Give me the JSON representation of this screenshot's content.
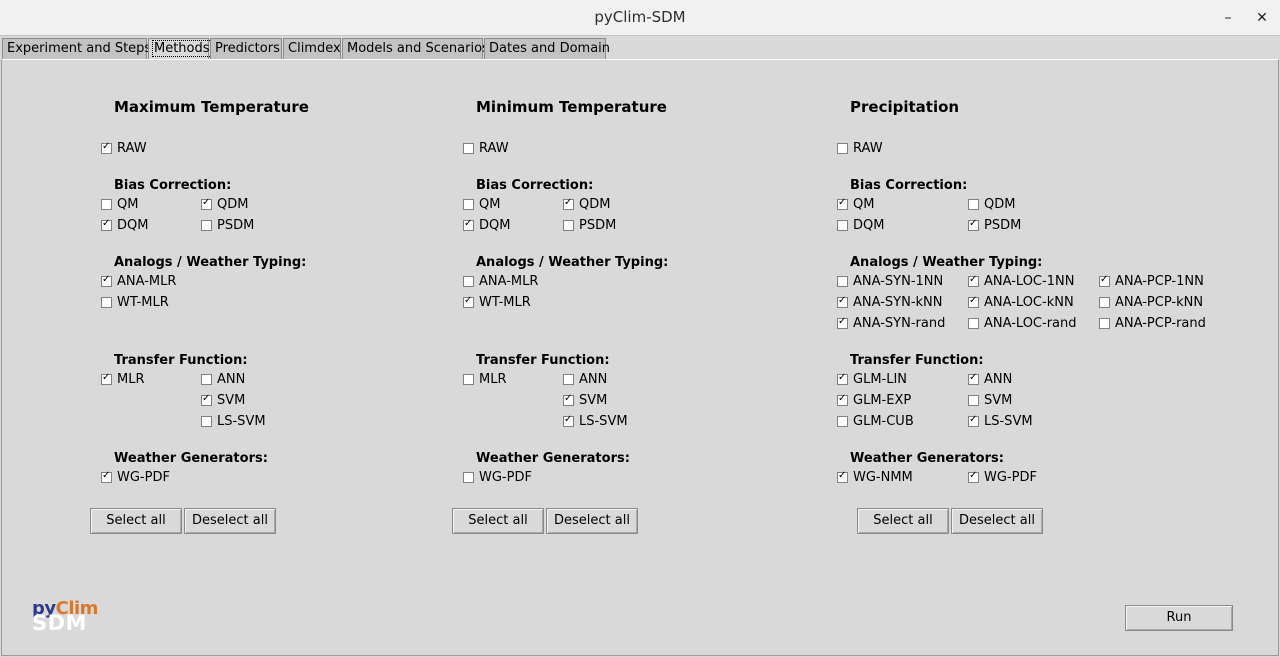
{
  "window": {
    "title": "pyClim-SDM",
    "minimize": "–",
    "close": "✕"
  },
  "tabs": [
    "Experiment and Steps",
    "Methods",
    "Predictors",
    "Climdex",
    "Models and Scenarios",
    "Dates and Domain"
  ],
  "active_tab": 1,
  "sections": {
    "bias": "Bias Correction:",
    "analogs": "Analogs / Weather Typing:",
    "transfer": "Transfer Function:",
    "wg": "Weather Generators:"
  },
  "columns": {
    "tmax": {
      "title": "Maximum Temperature",
      "raw": {
        "label": "RAW",
        "checked": true
      },
      "bias": [
        {
          "label": "QM",
          "checked": false
        },
        {
          "label": "QDM",
          "checked": true
        },
        {
          "label": "DQM",
          "checked": true
        },
        {
          "label": "PSDM",
          "checked": false
        }
      ],
      "analogs": [
        {
          "label": "ANA-MLR",
          "checked": true
        },
        {
          "label": "WT-MLR",
          "checked": false
        }
      ],
      "transfer": [
        {
          "label": "MLR",
          "checked": true
        },
        {
          "label": "ANN",
          "checked": false
        },
        {
          "label": "SVM",
          "checked": true
        },
        {
          "label": "LS-SVM",
          "checked": false
        }
      ],
      "wg": [
        {
          "label": "WG-PDF",
          "checked": true
        }
      ]
    },
    "tmin": {
      "title": "Minimum Temperature",
      "raw": {
        "label": "RAW",
        "checked": false
      },
      "bias": [
        {
          "label": "QM",
          "checked": false
        },
        {
          "label": "QDM",
          "checked": true
        },
        {
          "label": "DQM",
          "checked": true
        },
        {
          "label": "PSDM",
          "checked": false
        }
      ],
      "analogs": [
        {
          "label": "ANA-MLR",
          "checked": false
        },
        {
          "label": "WT-MLR",
          "checked": true
        }
      ],
      "transfer": [
        {
          "label": "MLR",
          "checked": false
        },
        {
          "label": "ANN",
          "checked": false
        },
        {
          "label": "SVM",
          "checked": true
        },
        {
          "label": "LS-SVM",
          "checked": true
        }
      ],
      "wg": [
        {
          "label": "WG-PDF",
          "checked": false
        }
      ]
    },
    "pcp": {
      "title": "Precipitation",
      "raw": {
        "label": "RAW",
        "checked": false
      },
      "bias": [
        {
          "label": "QM",
          "checked": true
        },
        {
          "label": "QDM",
          "checked": false
        },
        {
          "label": "DQM",
          "checked": false
        },
        {
          "label": "PSDM",
          "checked": true
        }
      ],
      "analogs": [
        {
          "label": "ANA-SYN-1NN",
          "checked": false
        },
        {
          "label": "ANA-LOC-1NN",
          "checked": true
        },
        {
          "label": "ANA-PCP-1NN",
          "checked": true
        },
        {
          "label": "ANA-SYN-kNN",
          "checked": true
        },
        {
          "label": "ANA-LOC-kNN",
          "checked": true
        },
        {
          "label": "ANA-PCP-kNN",
          "checked": false
        },
        {
          "label": "ANA-SYN-rand",
          "checked": true
        },
        {
          "label": "ANA-LOC-rand",
          "checked": false
        },
        {
          "label": "ANA-PCP-rand",
          "checked": false
        }
      ],
      "transfer": [
        {
          "label": "GLM-LIN",
          "checked": true
        },
        {
          "label": "ANN",
          "checked": true
        },
        {
          "label": "GLM-EXP",
          "checked": true
        },
        {
          "label": "SVM",
          "checked": false
        },
        {
          "label": "GLM-CUB",
          "checked": false
        },
        {
          "label": "LS-SVM",
          "checked": true
        }
      ],
      "wg": [
        {
          "label": "WG-NMM",
          "checked": true
        },
        {
          "label": "WG-PDF",
          "checked": true
        }
      ]
    }
  },
  "buttons": {
    "select_all": "Select all",
    "deselect_all": "Deselect all",
    "run": "Run"
  },
  "logo": {
    "line1_a": "py",
    "line1_b": "Clim",
    "line2": "SDM",
    "color_a": "#2b3a8c",
    "color_b": "#d9772b"
  }
}
